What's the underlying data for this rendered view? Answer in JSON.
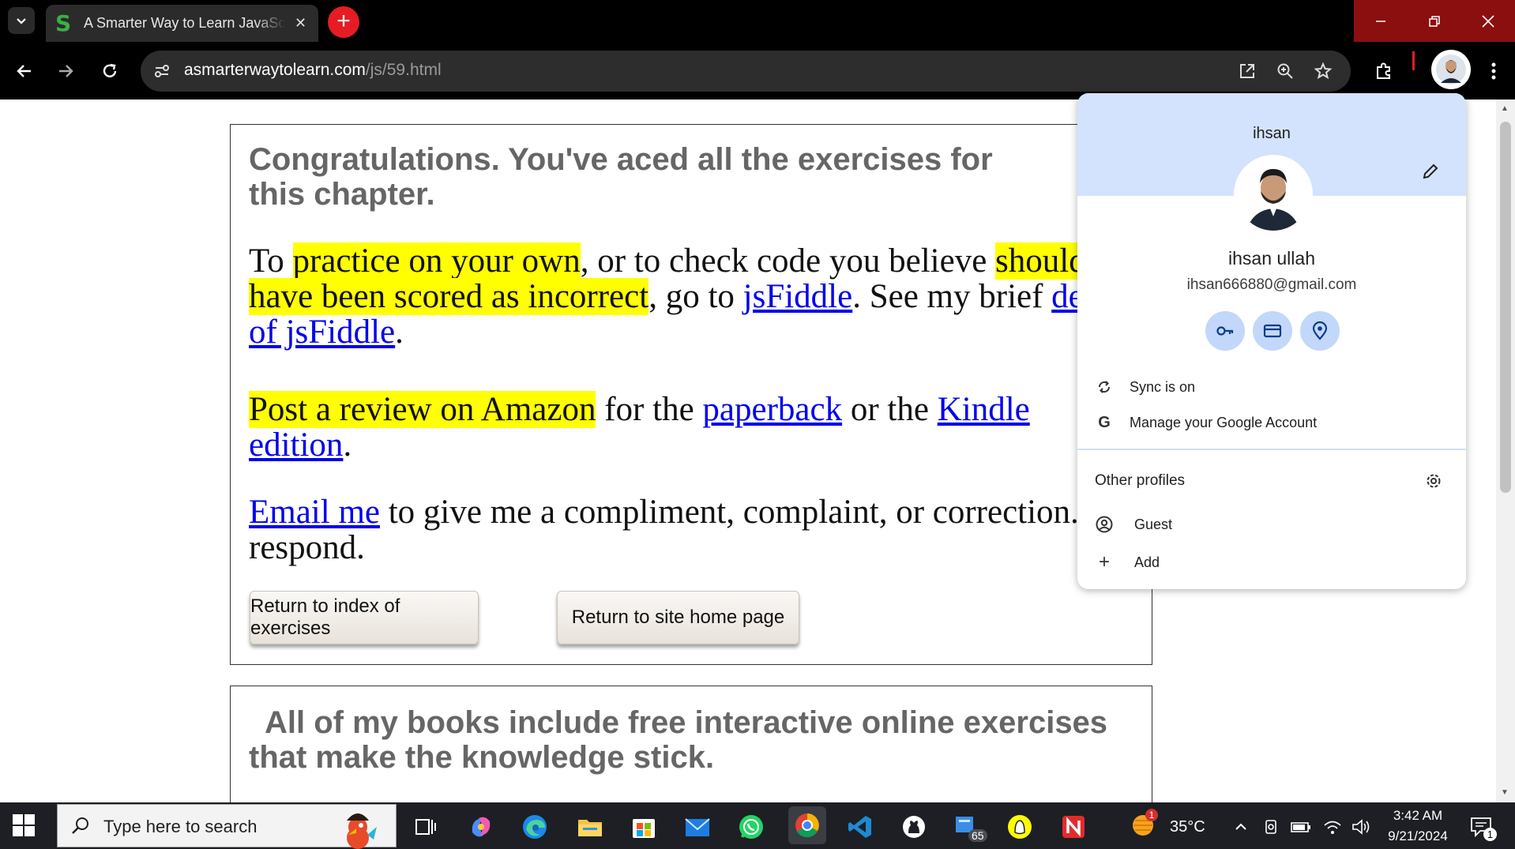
{
  "browser": {
    "tab_title": "A Smarter Way to Learn JavaScript",
    "tab_favicon": "S",
    "url_host": "asmarterwaytolearn.com",
    "url_path": "/js/59.html"
  },
  "page": {
    "congrats_heading": "Congratulations. You've aced all the exercises for this chapter.",
    "para1": {
      "t1": "To ",
      "h1": "practice on your own",
      "t2": ", or to check code you believe ",
      "h2": "should have been scored as incorrect",
      "t3": ", go to ",
      "link1": "jsFiddle",
      "t4": ". See my brief ",
      "link2": "demo of jsFiddle",
      "t5": "."
    },
    "para2": {
      "h1": "Post a review on Amazon",
      "t1": " for the ",
      "link1": "paperback",
      "t2": " or the ",
      "link2": "Kindle edition",
      "t3": "."
    },
    "para3": {
      "link1": "Email me",
      "t1": " to give me a compliment, complaint, or correction. I'll respond."
    },
    "button_index": "Return to index of exercises",
    "button_home": "Return to site home page",
    "books_heading": "All of my books include free interactive online exercises that make the knowledge stick."
  },
  "profile_menu": {
    "profile_name": "ihsan",
    "full_name": "ihsan ullah",
    "email": "ihsan666880@gmail.com",
    "sync_label": "Sync is on",
    "manage_label": "Manage your Google Account",
    "other_profiles_label": "Other profiles",
    "guest_label": "Guest",
    "add_label": "Add"
  },
  "taskbar": {
    "search_placeholder": "Type here to search",
    "temperature": "35°C",
    "time": "3:42 AM",
    "date": "9/21/2024",
    "weather_badge": "1",
    "folder_badge": "65",
    "notification_count": "1"
  },
  "colors": {
    "highlight": "#ffff00",
    "link": "#0000ee",
    "heading_gray": "#666666",
    "chrome_dark": "#000000",
    "profile_header": "#d3e3fd"
  }
}
